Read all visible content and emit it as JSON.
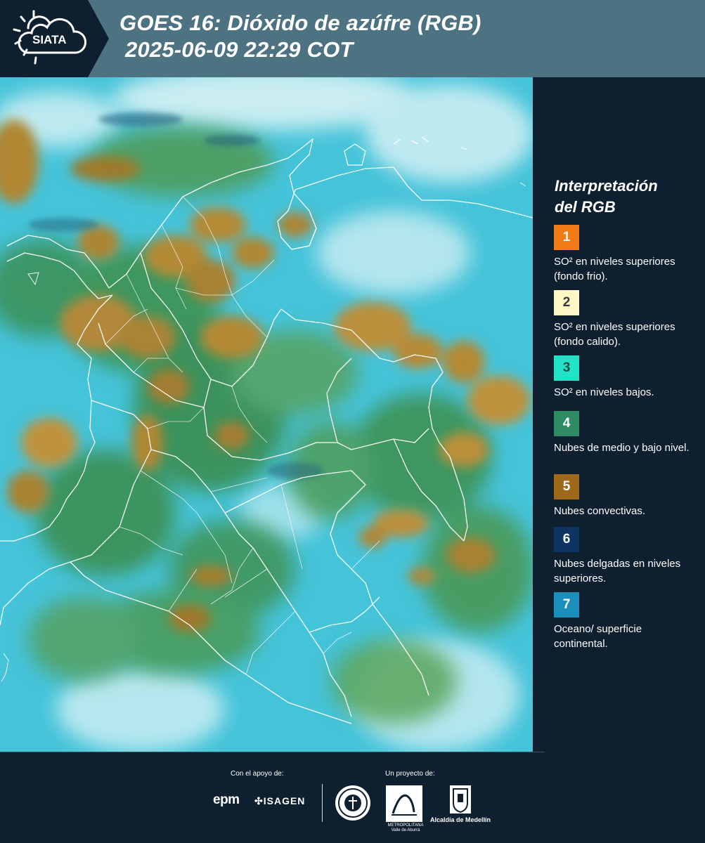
{
  "header": {
    "logo_text": "SIATA",
    "title_line1": "GOES 16: Dióxido de azúfre (RGB)",
    "title_line2": "2025-06-09 22:29 COT"
  },
  "legend": {
    "title_line1": "Interpretación",
    "title_line2": "del RGB",
    "items": [
      {
        "number": "1",
        "color": "#f47c17",
        "number_color": "#ffffff",
        "text": "SO² en niveles superiores (fondo frio)."
      },
      {
        "number": "2",
        "color": "#fff6c5",
        "number_color": "#3b3b3b",
        "text": "SO² en niveles superiores (fondo calido)."
      },
      {
        "number": "3",
        "color": "#22e3c6",
        "number_color": "#1b4a44",
        "text": "SO² en niveles bajos."
      },
      {
        "number": "4",
        "color": "#2e8b63",
        "number_color": "#ffffff",
        "text": "Nubes de medio y bajo nivel."
      },
      {
        "number": "5",
        "color": "#9e6a1a",
        "number_color": "#ffffff",
        "text": "Nubes convectivas."
      },
      {
        "number": "6",
        "color": "#0e3465",
        "number_color": "#ffffff",
        "text": "Nubes delgadas en niveles superiores."
      },
      {
        "number": "7",
        "color": "#1a8fbc",
        "number_color": "#ffffff",
        "text": "Oceano/ superficie continental."
      }
    ]
  },
  "footer": {
    "support_label": "Con el apoyo de:",
    "project_label": "Un proyecto de:",
    "sponsor1": "epm",
    "sponsor2": "ISAGEN",
    "partner_area": "METROPOLITANA Valle de Aburrá",
    "partner_alcaldia": "Alcaldía de Medellín"
  },
  "colors": {
    "header_bg": "#4d7281",
    "panel_bg": "#0e1f2f",
    "map_cyan": "#3fc6dc",
    "map_green": "#3a8f4a",
    "map_brown": "#b0862e"
  }
}
